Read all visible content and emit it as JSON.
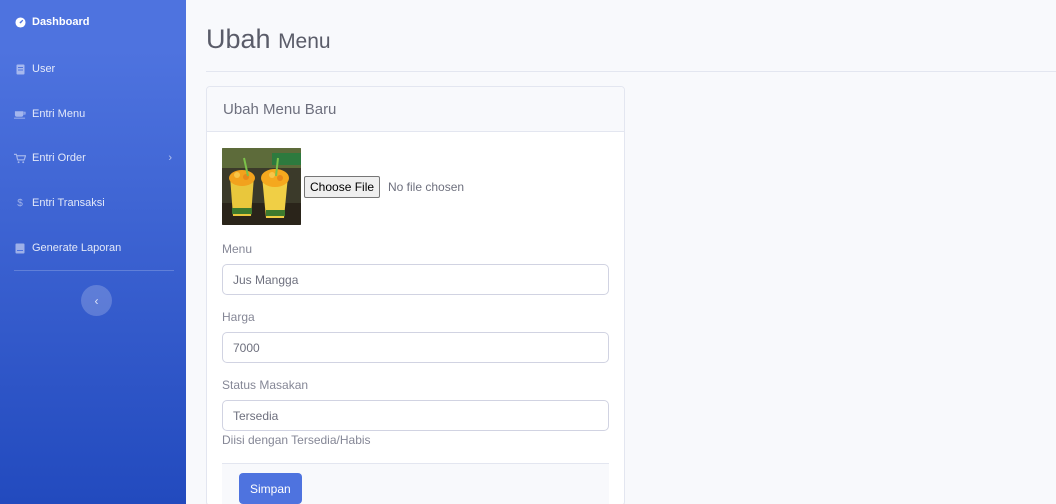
{
  "sidebar": {
    "items": [
      {
        "label": "Dashboard",
        "icon": "tachometer-icon",
        "active": true
      },
      {
        "label": "User",
        "icon": "user-icon"
      },
      {
        "label": "Entri Menu",
        "icon": "utensils-icon"
      },
      {
        "label": "Entri Order",
        "icon": "cart-icon",
        "has_submenu": true
      },
      {
        "label": "Entri Transaksi",
        "icon": "dollar-icon"
      },
      {
        "label": "Generate Laporan",
        "icon": "book-icon"
      }
    ],
    "toggle_icon": "chevron-left-icon"
  },
  "page": {
    "title_main": "Ubah",
    "title_sub": "Menu"
  },
  "card": {
    "header": "Ubah Menu Baru",
    "file_button": "Choose File",
    "file_status": "No file chosen",
    "fields": {
      "menu": {
        "label": "Menu",
        "value": "Jus Mangga"
      },
      "harga": {
        "label": "Harga",
        "value": "7000"
      },
      "status": {
        "label": "Status Masakan",
        "value": "Tersedia",
        "help": "Diisi dengan Tersedia/Habis"
      }
    },
    "submit_label": "Simpan"
  },
  "colors": {
    "primary": "#4e73df",
    "sidebar_bottom": "#224abe",
    "background": "#f8f9fc"
  }
}
